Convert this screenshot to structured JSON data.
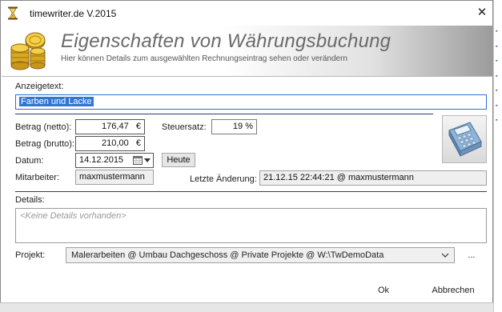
{
  "window": {
    "title": "timewriter.de V.2015",
    "close_glyph": "✕"
  },
  "banner": {
    "title": "Eigenschaften von Währungsbuchung",
    "subtitle": "Hier können Details zum ausgewählten Rechnungseintrag sehen oder verändern",
    "icon": "coins-icon"
  },
  "form": {
    "anzeigetext_label": "Anzeigetext:",
    "anzeigetext_value": "Farben und Lacke",
    "betrag_netto_label": "Betrag (netto):",
    "betrag_netto_value": "176,47",
    "betrag_brutto_label": "Betrag (brutto):",
    "betrag_brutto_value": "210,00",
    "currency": "€",
    "steuersatz_label": "Steuersatz:",
    "steuersatz_value": "19 %",
    "datum_label": "Datum:",
    "datum_value": "14.12.2015",
    "heute_label": "Heute",
    "mitarbeiter_label": "Mitarbeiter:",
    "mitarbeiter_value": "maxmustermann",
    "letzte_aenderung_label": "Letzte Änderung:",
    "letzte_aenderung_value": "21.12.15 22:44:21 @ maxmustermann",
    "details_label": "Details:",
    "details_placeholder": "<Keine Details vorhanden>",
    "projekt_label": "Projekt:",
    "projekt_value": "Malerarbeiten @ Umbau Dachgeschoss @ Private Projekte @ W:\\TwDemoData",
    "projekt_more": "..."
  },
  "buttons": {
    "ok": "Ok",
    "cancel": "Abbrechen"
  },
  "colors": {
    "accent_line": "#2d3a7a",
    "selection": "#3077d3"
  }
}
